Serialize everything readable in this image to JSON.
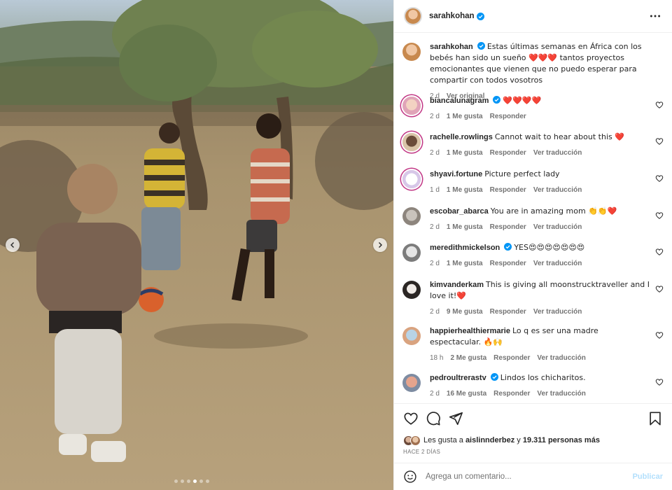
{
  "post": {
    "author": "sarahkohan",
    "caption_user": "sarahkohan",
    "caption_text": "Estas últimas semanas en África con los bebés han sido un sueño ❤️❤️❤️ tantos proyectos emocionantes que vienen que no puedo esperar para compartir con todos vosotros",
    "caption_time": "2 d",
    "see_original": "Ver original"
  },
  "comments": [
    {
      "user": "biancalunagram",
      "verified": true,
      "text": "❤️❤️❤️❤️",
      "time": "2 d",
      "likes": "1 Me gusta",
      "reply": "Responder",
      "translate": ""
    },
    {
      "user": "rachelle.rowlings",
      "verified": false,
      "text": "Cannot wait to hear about this ❤️",
      "time": "2 d",
      "likes": "1 Me gusta",
      "reply": "Responder",
      "translate": "Ver traducción"
    },
    {
      "user": "shyavi.fortune",
      "verified": false,
      "text": "Picture perfect lady",
      "time": "1 d",
      "likes": "1 Me gusta",
      "reply": "Responder",
      "translate": "Ver traducción"
    },
    {
      "user": "escobar_abarca",
      "verified": false,
      "text": "You are in amazing mom 👏👏❤️",
      "time": "2 d",
      "likes": "1 Me gusta",
      "reply": "Responder",
      "translate": "Ver traducción"
    },
    {
      "user": "meredithmickelson",
      "verified": true,
      "text": "YES😍😍😍😍😍😍😍",
      "time": "2 d",
      "likes": "1 Me gusta",
      "reply": "Responder",
      "translate": "Ver traducción"
    },
    {
      "user": "kimvanderkam",
      "verified": false,
      "text": "This is giving all moonstrucktraveller and I love it!❤️",
      "time": "2 d",
      "likes": "9 Me gusta",
      "reply": "Responder",
      "translate": "Ver traducción"
    },
    {
      "user": "happierhealthiermarie",
      "verified": false,
      "text": "Lo q es ser una madre espectacular. 🔥🙌",
      "time": "18 h",
      "likes": "2 Me gusta",
      "reply": "Responder",
      "translate": "Ver traducción"
    },
    {
      "user": "pedroultrerastv",
      "verified": true,
      "text": "Lindos los chicharitos.",
      "time": "2 d",
      "likes": "16 Me gusta",
      "reply": "Responder",
      "translate": "Ver traducción"
    }
  ],
  "likes": {
    "prefix": "Les gusta a",
    "first_user": "aislinnderbez",
    "connector": "y",
    "others": "19.311 personas más"
  },
  "date_label": "HACE 2 DÍAS",
  "add_comment": {
    "placeholder": "Agrega un comentario...",
    "publish": "Publicar"
  },
  "carousel": {
    "count": 6,
    "active": 3
  },
  "colors": {
    "verified": "#0095f6",
    "heart": "#ed4956",
    "muted": "#737373",
    "publish": "#b2dffc"
  },
  "icons": {
    "header": [
      "more-options-icon"
    ],
    "actions": [
      "heart-icon",
      "comment-icon",
      "share-icon",
      "bookmark-icon"
    ],
    "photo": [
      "chevron-left-icon",
      "chevron-right-icon"
    ],
    "comment_row": [
      "heart-outline-icon"
    ],
    "input": [
      "emoji-icon"
    ]
  }
}
